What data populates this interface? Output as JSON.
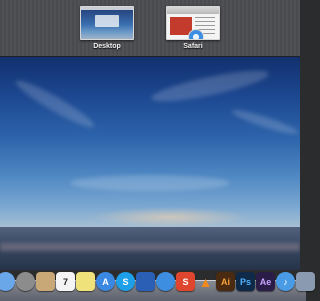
{
  "mission_control": {
    "spaces": [
      {
        "label": "Desktop"
      },
      {
        "label": "Safari"
      }
    ]
  },
  "dock": {
    "items": [
      {
        "icon": "finder-icon",
        "glyph": "",
        "color": "#6aa7e8"
      },
      {
        "icon": "system-preferences-icon",
        "glyph": "",
        "color": "#8c8c8c"
      },
      {
        "icon": "contacts-icon",
        "glyph": "",
        "color": "#c9a877"
      },
      {
        "icon": "calendar-icon",
        "glyph": "7",
        "color": "#f4f4f4"
      },
      {
        "icon": "notes-icon",
        "glyph": "",
        "color": "#f0e27a"
      },
      {
        "icon": "app-store-icon",
        "glyph": "A",
        "color": "#3b88e2"
      },
      {
        "icon": "skype-icon",
        "glyph": "S",
        "color": "#1ea0e8"
      },
      {
        "icon": "xcode-icon",
        "glyph": "",
        "color": "#2b5fb5"
      },
      {
        "icon": "safari-icon",
        "glyph": "",
        "color": "#3d8ee0"
      },
      {
        "icon": "scrivener-icon",
        "glyph": "S",
        "color": "#e0452e"
      },
      {
        "icon": "vlc-icon",
        "glyph": "▲",
        "color": "#e98424"
      },
      {
        "icon": "illustrator-icon",
        "glyph": "Ai",
        "color": "#4a2a10"
      },
      {
        "icon": "photoshop-icon",
        "glyph": "Ps",
        "color": "#0f2a48"
      },
      {
        "icon": "after-effects-icon",
        "glyph": "Ae",
        "color": "#2a1e48"
      },
      {
        "icon": "itunes-icon",
        "glyph": "♪",
        "color": "#4a9be6"
      },
      {
        "icon": "preview-icon",
        "glyph": "",
        "color": "#8a9ab0"
      }
    ]
  }
}
